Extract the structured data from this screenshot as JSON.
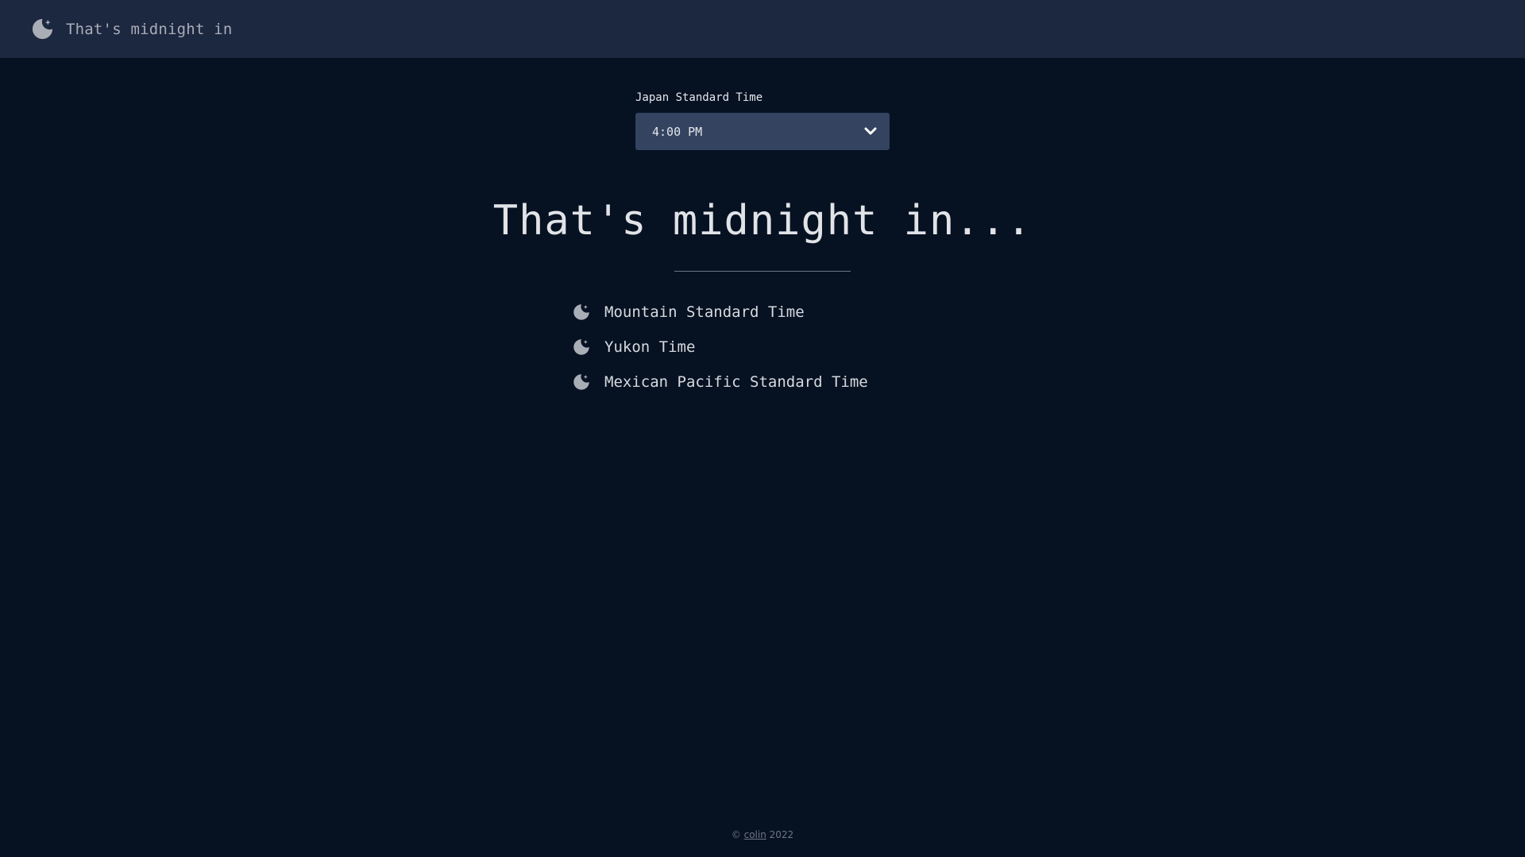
{
  "navbar": {
    "brand_text": "That's midnight in",
    "brand_icon": "moon-icon"
  },
  "picker": {
    "label": "Japan Standard Time",
    "selected_value": "4:00 PM"
  },
  "main": {
    "heading": "That's midnight in...",
    "zones": [
      {
        "label": "Mountain Standard Time",
        "icon": "moon-icon"
      },
      {
        "label": "Yukon Time",
        "icon": "moon-icon"
      },
      {
        "label": "Mexican Pacific Standard Time",
        "icon": "moon-icon"
      }
    ]
  },
  "footer": {
    "copyright_symbol": "©",
    "author_link": "colin",
    "year": "2022"
  },
  "colors": {
    "background": "#061122",
    "navbar": "#1c2740",
    "select": "#34435f",
    "moon": "#a9adb6"
  }
}
